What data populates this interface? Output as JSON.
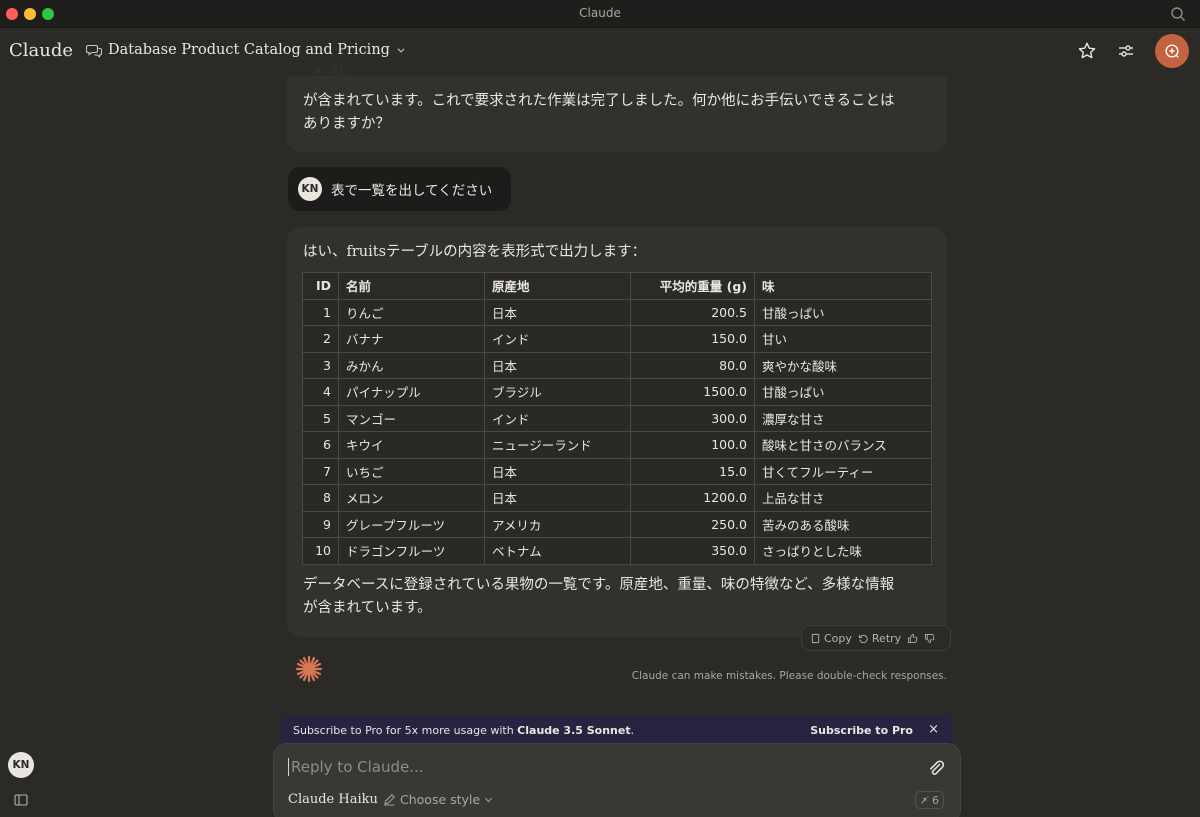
{
  "window": {
    "title": "Claude"
  },
  "header": {
    "brand": "Claude",
    "chat_title": "Database Product Catalog and Pricing"
  },
  "previous_message": {
    "bullet": "味",
    "text": "が含まれています。これで要求された作業は完了しました。何か他にお手伝いできることはありますか？"
  },
  "user_message": {
    "avatar": "KN",
    "text": "表で一覧を出してください"
  },
  "response": {
    "intro": "はい、fruitsテーブルの内容を表形式で出力します：",
    "table": {
      "headers": [
        "ID",
        "名前",
        "原産地",
        "平均的重量 (g)",
        "味"
      ],
      "rows": [
        [
          "1",
          "りんご",
          "日本",
          "200.5",
          "甘酸っぱい"
        ],
        [
          "2",
          "バナナ",
          "インド",
          "150.0",
          "甘い"
        ],
        [
          "3",
          "みかん",
          "日本",
          "80.0",
          "爽やかな酸味"
        ],
        [
          "4",
          "パイナップル",
          "ブラジル",
          "1500.0",
          "甘酸っぱい"
        ],
        [
          "5",
          "マンゴー",
          "インド",
          "300.0",
          "濃厚な甘さ"
        ],
        [
          "6",
          "キウイ",
          "ニュージーランド",
          "100.0",
          "酸味と甘さのバランス"
        ],
        [
          "7",
          "いちご",
          "日本",
          "15.0",
          "甘くてフルーティー"
        ],
        [
          "8",
          "メロン",
          "日本",
          "1200.0",
          "上品な甘さ"
        ],
        [
          "9",
          "グレープフルーツ",
          "アメリカ",
          "250.0",
          "苦みのある酸味"
        ],
        [
          "10",
          "ドラゴンフルーツ",
          "ベトナム",
          "350.0",
          "さっぱりとした味"
        ]
      ]
    },
    "outro": "データベースに登録されている果物の一覧です。原産地、重量、味の特徴など、多様な情報が含まれています。"
  },
  "actions": {
    "copy": "Copy",
    "retry": "Retry"
  },
  "disclaimer": "Claude can make mistakes. Please double-check responses.",
  "promo": {
    "text_prefix": "Subscribe to Pro for 5x more usage with ",
    "text_bold": "Claude 3.5 Sonnet",
    "text_suffix": ".",
    "button": "Subscribe to Pro",
    "close": "×"
  },
  "composer": {
    "placeholder": "Reply to Claude...",
    "model": "Claude Haiku",
    "style": "Choose style",
    "count": "6"
  },
  "sidebar": {
    "avatar": "KN"
  },
  "colors": {
    "accent": "#c4633f",
    "background": "#2b2a27",
    "card": "#32312d",
    "promo": "#262441"
  }
}
